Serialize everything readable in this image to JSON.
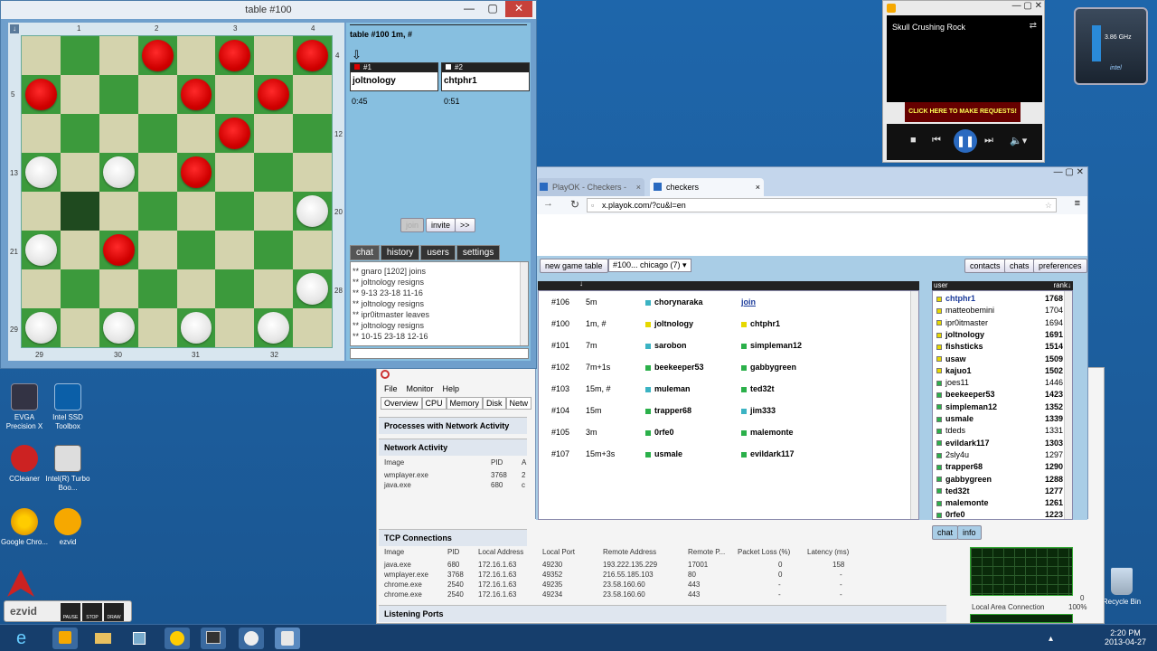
{
  "checkers_window": {
    "title": "table #100",
    "top_labels": [
      "1",
      "2",
      "3",
      "4"
    ],
    "left_labels": [
      "4",
      "5",
      "",
      "13",
      "",
      "21",
      "",
      "29"
    ],
    "right_labels": [
      "",
      "",
      "12",
      "",
      "20",
      "",
      "28",
      ""
    ],
    "bottom_labels": [
      "29",
      "30",
      "31",
      "32"
    ],
    "board": [
      [
        "",
        "",
        "",
        "r",
        "",
        "r",
        "",
        "r"
      ],
      [
        "r",
        "",
        "",
        "",
        "r",
        "",
        "r",
        ""
      ],
      [
        "",
        "",
        "",
        "",
        "",
        "r",
        "",
        ""
      ],
      [
        "w",
        "",
        "w",
        "",
        "r",
        "",
        "",
        ""
      ],
      [
        "",
        "x",
        "",
        "",
        "",
        "",
        "",
        "w"
      ],
      [
        "w",
        "",
        "r",
        "",
        "",
        "",
        "",
        ""
      ],
      [
        "",
        "",
        "",
        "",
        "",
        "",
        "",
        "w"
      ],
      [
        "w",
        "",
        "w",
        "",
        "w",
        "",
        "w",
        ""
      ]
    ],
    "table_header": "table #100    1m, #",
    "player1_tag": "#1",
    "player1_name": "joltnology",
    "player1_time": "0:45",
    "player2_tag": "#2",
    "player2_name": "chtphr1",
    "player2_time": "0:51",
    "btn_join": "join",
    "btn_invite": "invite",
    "btn_more": ">>",
    "tabs": [
      "chat",
      "history",
      "users",
      "settings"
    ],
    "chat_lines": [
      "** gnaro [1202] joins",
      "** joltnology resigns",
      "** 9-13 23-18 11-16",
      "** joltnology resigns",
      "** ipr0itmaster leaves",
      "** joltnology resigns",
      "** 10-15 23-18 12-16"
    ]
  },
  "media": {
    "title": "Skull Crushing Rock",
    "banner": "CLICK HERE TO MAKE REQUESTS!"
  },
  "cpu_widget": {
    "freq": "3.86 GHz"
  },
  "browser": {
    "tab1": "PlayOK - Checkers - Play",
    "tab2": "checkers",
    "url": "x.playok.com/?cu&l=en",
    "new_game": "new game table",
    "room_select": "#100... chicago (7)",
    "btn_contacts": "contacts",
    "btn_chats": "chats",
    "btn_preferences": "preferences",
    "tables": [
      {
        "id": "#106",
        "time": "5m",
        "p1": "chorynaraka",
        "p1c": "#3bb3c3",
        "p2": "join",
        "p2c": ""
      },
      {
        "id": "#100",
        "time": "1m, #",
        "p1": "joltnology",
        "p1c": "#e6d800",
        "p2": "chtphr1",
        "p2c": "#e6d800"
      },
      {
        "id": "#101",
        "time": "7m",
        "p1": "sarobon",
        "p1c": "#3bb3c3",
        "p2": "simpleman12",
        "p2c": "#2bb04a"
      },
      {
        "id": "#102",
        "time": "7m+1s",
        "p1": "beekeeper53",
        "p1c": "#2bb04a",
        "p2": "gabbygreen",
        "p2c": "#2bb04a"
      },
      {
        "id": "#103",
        "time": "15m, #",
        "p1": "muleman",
        "p1c": "#3bb3c3",
        "p2": "ted32t",
        "p2c": "#2bb04a"
      },
      {
        "id": "#104",
        "time": "15m",
        "p1": "trapper68",
        "p1c": "#2bb04a",
        "p2": "jim333",
        "p2c": "#3bb3c3"
      },
      {
        "id": "#105",
        "time": "3m",
        "p1": "0rfe0",
        "p1c": "#2bb04a",
        "p2": "malemonte",
        "p2c": "#2bb04a"
      },
      {
        "id": "#107",
        "time": "15m+3s",
        "p1": "usmale",
        "p1c": "#2bb04a",
        "p2": "evildark117",
        "p2c": "#2bb04a"
      }
    ],
    "users_header": "user",
    "rank_header": "rank↓",
    "users": [
      {
        "n": "chtphr1",
        "r": "1768",
        "c": "#e6d800",
        "b": true
      },
      {
        "n": "matteobemini",
        "r": "1704",
        "c": "#e6d800",
        "b": false
      },
      {
        "n": "ipr0itmaster",
        "r": "1694",
        "c": "#e6d800",
        "b": false
      },
      {
        "n": "joltnology",
        "r": "1691",
        "c": "#e6d800",
        "b": true
      },
      {
        "n": "fishsticks",
        "r": "1514",
        "c": "#e6d800",
        "b": true
      },
      {
        "n": "usaw",
        "r": "1509",
        "c": "#e6d800",
        "b": true
      },
      {
        "n": "kajuo1",
        "r": "1502",
        "c": "#e6d800",
        "b": true
      },
      {
        "n": "joes11",
        "r": "1446",
        "c": "#2bb04a",
        "b": false
      },
      {
        "n": "beekeeper53",
        "r": "1423",
        "c": "#2bb04a",
        "b": true
      },
      {
        "n": "simpleman12",
        "r": "1352",
        "c": "#2bb04a",
        "b": true
      },
      {
        "n": "usmale",
        "r": "1339",
        "c": "#2bb04a",
        "b": true
      },
      {
        "n": "tdeds",
        "r": "1331",
        "c": "#2bb04a",
        "b": false
      },
      {
        "n": "evildark117",
        "r": "1303",
        "c": "#2bb04a",
        "b": true
      },
      {
        "n": "2sly4u",
        "r": "1297",
        "c": "#2bb04a",
        "b": false
      },
      {
        "n": "trapper68",
        "r": "1290",
        "c": "#2bb04a",
        "b": true
      },
      {
        "n": "gabbygreen",
        "r": "1288",
        "c": "#2bb04a",
        "b": true
      },
      {
        "n": "ted32t",
        "r": "1277",
        "c": "#2bb04a",
        "b": true
      },
      {
        "n": "malemonte",
        "r": "1261",
        "c": "#2bb04a",
        "b": true
      },
      {
        "n": "0rfe0",
        "r": "1223",
        "c": "#2bb04a",
        "b": true
      }
    ],
    "btn_chat": "chat",
    "btn_info": "info"
  },
  "taskmgr": {
    "menu": [
      "File",
      "Monitor",
      "Help"
    ],
    "tabs": [
      "Overview",
      "CPU",
      "Memory",
      "Disk",
      "Netw"
    ],
    "sec_processes": "Processes with Network Activity",
    "sec_network": "Network Activity",
    "net_headers": [
      "Image",
      "PID",
      "A"
    ],
    "net_rows": [
      [
        "wmplayer.exe",
        "3768",
        "2"
      ],
      [
        "java.exe",
        "680",
        "c"
      ]
    ],
    "sec_tcp": "TCP Connections",
    "tcp_headers": [
      "Image",
      "PID",
      "Local Address",
      "Local Port",
      "Remote Address",
      "Remote P...",
      "Packet Loss (%)",
      "Latency (ms)"
    ],
    "tcp_rows": [
      [
        "java.exe",
        "680",
        "172.16.1.63",
        "49230",
        "193.222.135.229",
        "17001",
        "0",
        "158"
      ],
      [
        "wmplayer.exe",
        "3768",
        "172.16.1.63",
        "49352",
        "216.55.185.103",
        "80",
        "0",
        "-"
      ],
      [
        "chrome.exe",
        "2540",
        "172.16.1.63",
        "49235",
        "23.58.160.60",
        "443",
        "-",
        "-"
      ],
      [
        "chrome.exe",
        "2540",
        "172.16.1.63",
        "49234",
        "23.58.160.60",
        "443",
        "-",
        "-"
      ]
    ],
    "sec_listening": "Listening Ports",
    "graph_label": "Local Area Connection",
    "graph_pct": "100%",
    "graph_zero": "0"
  },
  "desktop_icons": [
    {
      "label": "EVGA Precision X"
    },
    {
      "label": "Intel SSD Toolbox"
    },
    {
      "label": "CCleaner"
    },
    {
      "label": "Intel(R) Turbo Boo..."
    },
    {
      "label": "Google Chro..."
    },
    {
      "label": "ezvid"
    },
    {
      "label": "Recycle Bin"
    }
  ],
  "ezvid": {
    "pause": "PAUSE",
    "stop": "STOP",
    "draw": "DRAW"
  },
  "clock": {
    "time": "2:20 PM",
    "date": "2013-04-27"
  }
}
